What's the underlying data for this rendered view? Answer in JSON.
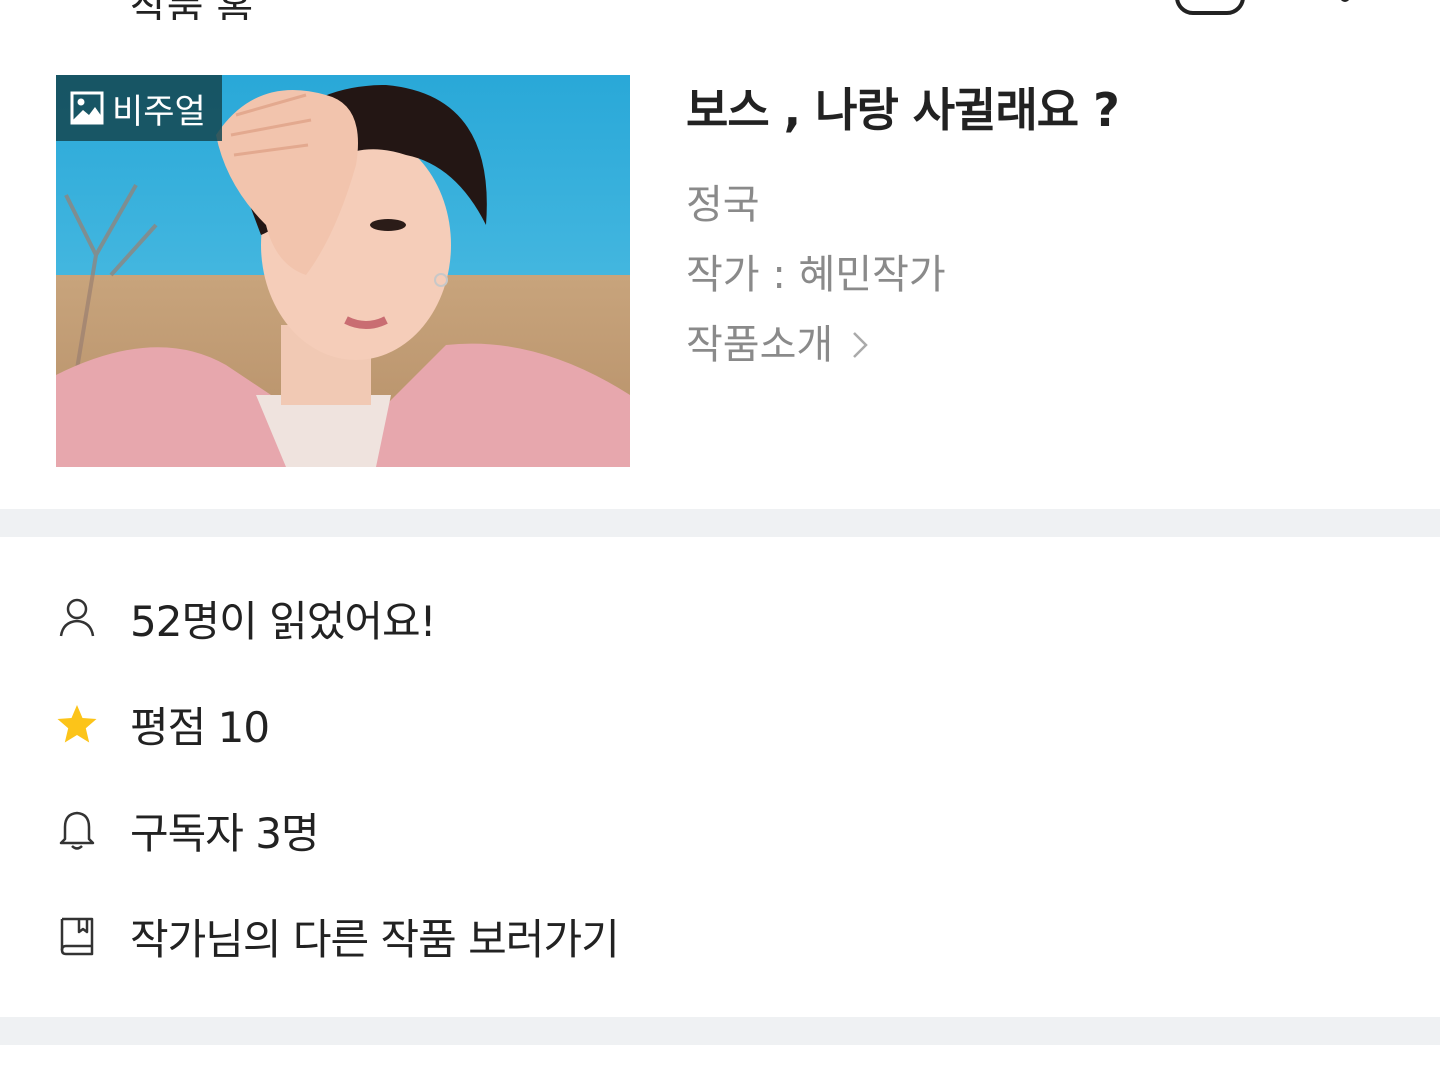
{
  "topbar": {
    "partial_title": "작품 홈"
  },
  "hero": {
    "badge_label": "비주얼",
    "badge_icon": "image-icon"
  },
  "work": {
    "title": "보스 , 나랑 사귈래요 ?",
    "genre": "정국",
    "author": "작가 : 혜민작가",
    "intro_label": "작품소개"
  },
  "stats": {
    "readers": "52명이 읽었어요!",
    "rating": "평점 10",
    "subscribers": "구독자 3명",
    "other_works": "작가님의 다른 작품 보러가기"
  },
  "colors": {
    "divider": "#eff1f3",
    "muted_text": "#8a8a8a",
    "star": "#fcc419",
    "badge_bg": "#14465080"
  }
}
